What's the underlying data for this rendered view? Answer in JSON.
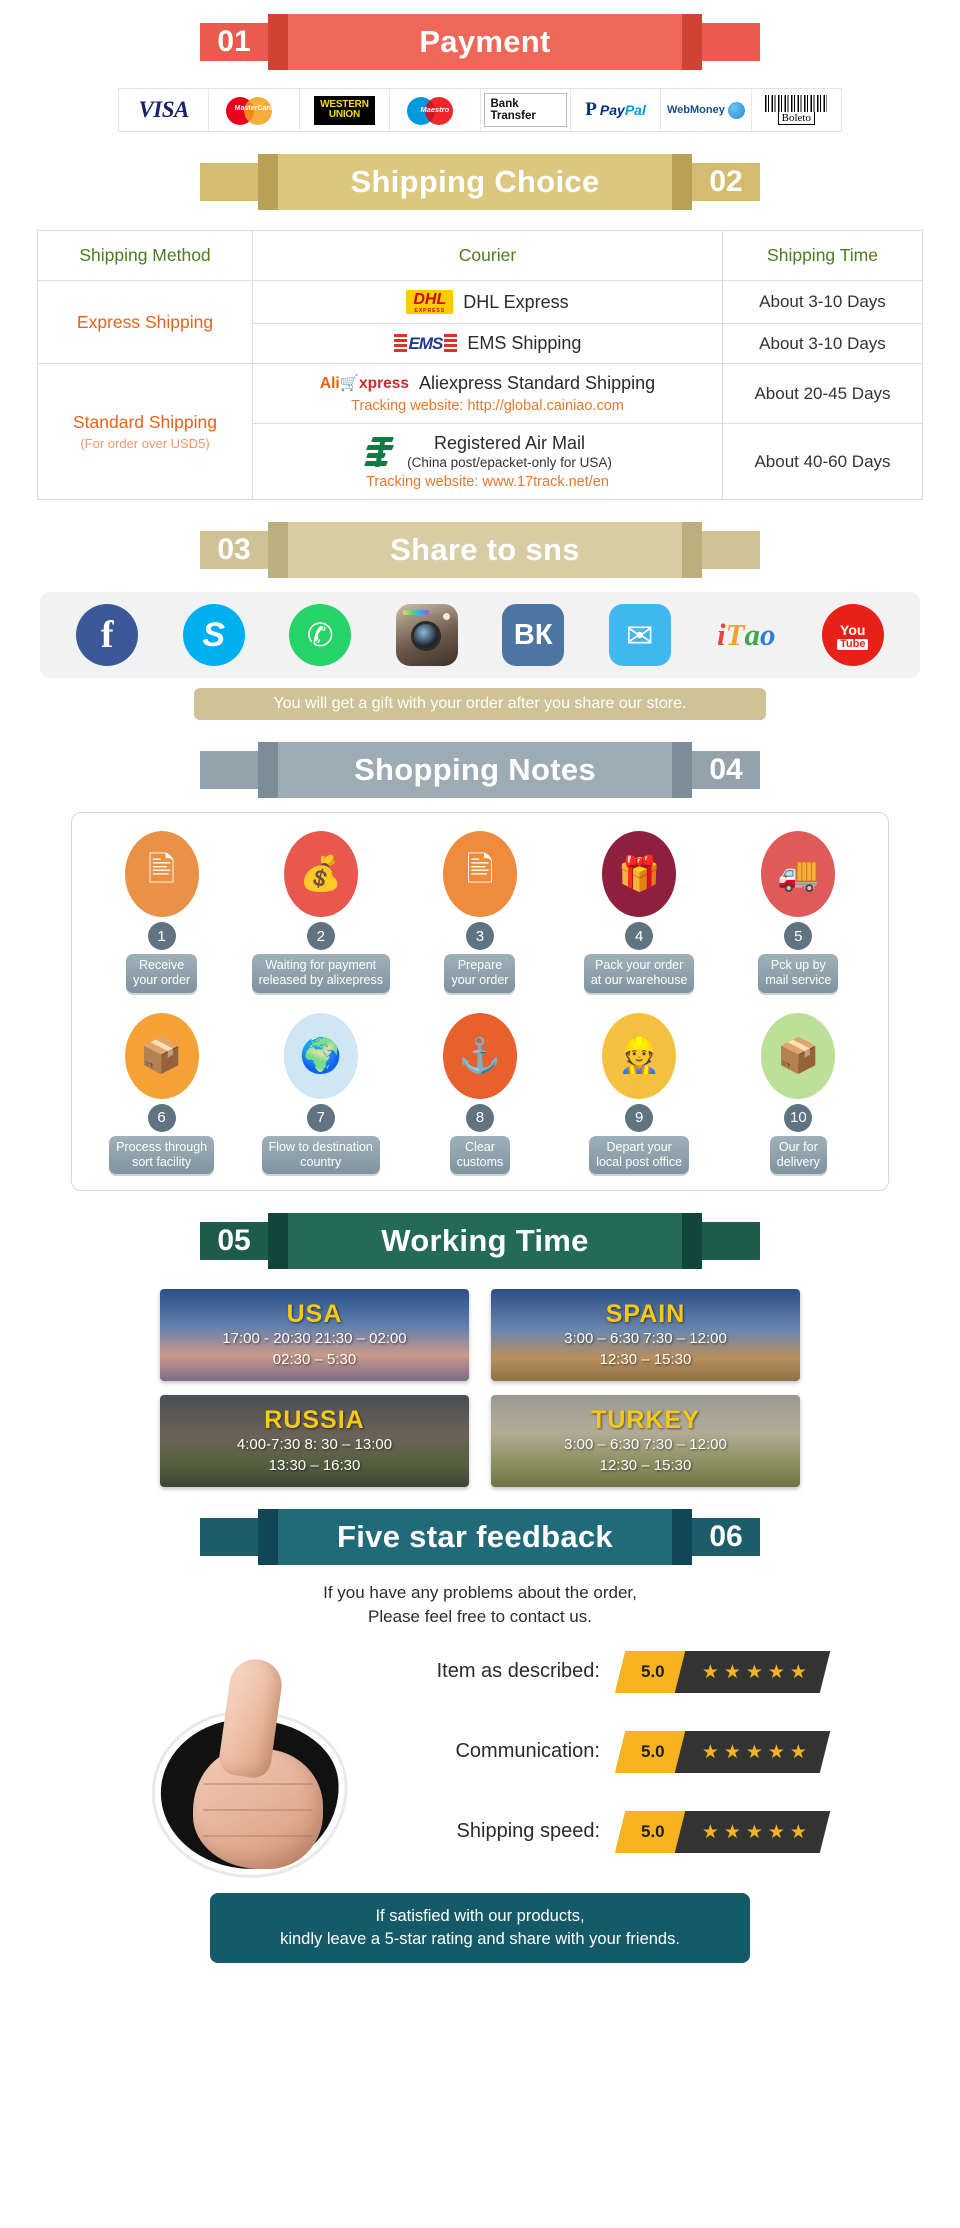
{
  "sections": {
    "payment": {
      "number": "01",
      "title": "Payment"
    },
    "shipping": {
      "number": "02",
      "title": "Shipping Choice"
    },
    "share": {
      "number": "03",
      "title": "Share to sns"
    },
    "notes": {
      "number": "04",
      "title": "Shopping Notes"
    },
    "working": {
      "number": "05",
      "title": "Working Time"
    },
    "feedback": {
      "number": "06",
      "title": "Five star feedback"
    }
  },
  "payment_methods": [
    {
      "name": "visa",
      "label": "VISA"
    },
    {
      "name": "mastercard",
      "label": "MasterCard"
    },
    {
      "name": "western-union",
      "line1": "WESTERN",
      "line2": "UNION"
    },
    {
      "name": "maestro",
      "label": "Maestro"
    },
    {
      "name": "bank-transfer",
      "label": "Bank Transfer"
    },
    {
      "name": "paypal",
      "label_pay": "Pay",
      "label_pal": "Pal"
    },
    {
      "name": "webmoney",
      "label": "WebMoney"
    },
    {
      "name": "boleto",
      "label": "Boleto"
    }
  ],
  "shipping_table": {
    "headers": [
      "Shipping Method",
      "Courier",
      "Shipping Time"
    ],
    "rows": [
      {
        "method": "Express Shipping",
        "method_sub": "",
        "couriers": [
          {
            "logo": "dhl",
            "name": "DHL Express",
            "sub": "",
            "track": "",
            "time": "About 3-10 Days"
          },
          {
            "logo": "ems",
            "name": "EMS Shipping",
            "sub": "",
            "track": "",
            "time": "About 3-10 Days"
          }
        ]
      },
      {
        "method": "Standard Shipping",
        "method_sub": "(For order over USD5)",
        "couriers": [
          {
            "logo": "aliexpress",
            "name": "Aliexpress Standard Shipping",
            "sub": "",
            "track": "Tracking website: http://global.cainiao.com",
            "time": "About 20-45 Days"
          },
          {
            "logo": "chinapost",
            "name": "Registered Air Mail",
            "sub": "(China post/epacket-only for USA)",
            "track": "Tracking website: www.17track.net/en",
            "time": "About 40-60 Days"
          }
        ]
      }
    ]
  },
  "social": {
    "items": [
      {
        "name": "facebook-icon",
        "label": "f"
      },
      {
        "name": "skype-icon",
        "label": "S"
      },
      {
        "name": "whatsapp-icon",
        "label": "✆"
      },
      {
        "name": "instagram-icon",
        "label": ""
      },
      {
        "name": "vk-icon",
        "label": "ВК"
      },
      {
        "name": "twitter-icon",
        "label": "✉"
      },
      {
        "name": "itao-icon",
        "label": "iTao"
      },
      {
        "name": "youtube-icon",
        "label_y": "You",
        "label_tube": "Tube"
      }
    ],
    "gift_note": "You will get a gift with your order after you share our store."
  },
  "shopping_notes": [
    {
      "index": "1",
      "label": "Receive\nyour order",
      "icon": "document-icon",
      "color": "#e99145"
    },
    {
      "index": "2",
      "label": "Waiting for payment\nreleased by alixepress",
      "icon": "money-bag-icon",
      "color": "#e8584f"
    },
    {
      "index": "3",
      "label": "Prepare\nyour order",
      "icon": "document-icon",
      "color": "#ef8b3d"
    },
    {
      "index": "4",
      "label": "Pack your order\nat our warehouse",
      "icon": "gift-icon",
      "color": "#8e1f3d"
    },
    {
      "index": "5",
      "label": "Pck up by\nmail service",
      "icon": "mail-truck-icon",
      "color": "#e05a5a"
    },
    {
      "index": "6",
      "label": "Process through\nsort facility",
      "icon": "hand-truck-icon",
      "color": "#f4a135"
    },
    {
      "index": "7",
      "label": "Flow to destination\ncountry",
      "icon": "globe-icon",
      "color": "#cfe6f5"
    },
    {
      "index": "8",
      "label": "Clear\ncustoms",
      "icon": "anchor-icon",
      "color": "#e8602c"
    },
    {
      "index": "9",
      "label": "Depart your\nlocal post office",
      "icon": "postman-icon",
      "color": "#f6c03f"
    },
    {
      "index": "10",
      "label": "Our for\ndelivery",
      "icon": "parcel-icon",
      "color": "#bcdf9a"
    }
  ],
  "working_time": [
    {
      "country": "USA",
      "theme": "usa",
      "line1": "17:00 - 20:30  21:30 – 02:00",
      "line2": "02:30 – 5:30"
    },
    {
      "country": "SPAIN",
      "theme": "spain",
      "line1": "3:00 – 6:30   7:30 – 12:00",
      "line2": "12:30 – 15:30"
    },
    {
      "country": "RUSSIA",
      "theme": "russia",
      "line1": "4:00-7:30   8: 30 – 13:00",
      "line2": "13:30 – 16:30"
    },
    {
      "country": "TURKEY",
      "theme": "turkey",
      "line1": "3:00 – 6:30   7:30 – 12:00",
      "line2": "12:30 – 15:30"
    }
  ],
  "feedback": {
    "intro_line1": "If you have any problems about the order,",
    "intro_line2": "Please feel free to contact us.",
    "ratings": [
      {
        "label": "Item as described:",
        "score": "5.0",
        "stars": 5
      },
      {
        "label": "Communication:",
        "score": "5.0",
        "stars": 5
      },
      {
        "label": "Shipping speed:",
        "score": "5.0",
        "stars": 5
      }
    ],
    "final_line1": "If satisfied with our products,",
    "final_line2": "kindly leave a 5-star rating and share with your friends."
  }
}
